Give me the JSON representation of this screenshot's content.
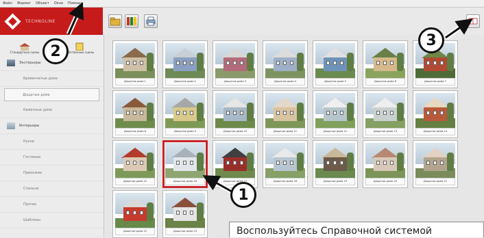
{
  "menu": [
    "Файл",
    "Формат",
    "Объект",
    "Окна",
    "Помощь"
  ],
  "logo_text": "TECHNOLINE",
  "sidebar": {
    "tabs": [
      {
        "label": "Стандартные сцены",
        "icon": "house-icon"
      },
      {
        "label": "Собственные сцены",
        "icon": "notepad-icon"
      }
    ],
    "items": [
      {
        "label": "Экстерьеры",
        "type": "group",
        "icon": "exterior-icon"
      },
      {
        "label": "Бревенчатые дома",
        "type": "item"
      },
      {
        "label": "Дощатые дома",
        "type": "item",
        "active": true
      },
      {
        "label": "Каменные дома",
        "type": "item"
      },
      {
        "label": "Интерьеры",
        "type": "group",
        "icon": "interior-icon"
      },
      {
        "label": "Кухни",
        "type": "item"
      },
      {
        "label": "Гостиные",
        "type": "item"
      },
      {
        "label": "Прихожие",
        "type": "item"
      },
      {
        "label": "Спальни",
        "type": "item"
      },
      {
        "label": "Прочее",
        "type": "item"
      },
      {
        "label": "Шаблоны",
        "type": "item"
      }
    ]
  },
  "toolbar": {
    "buttons": [
      {
        "name": "open-folder-button",
        "icon": "folder-icon"
      },
      {
        "name": "palette-button",
        "icon": "palette-icon"
      },
      {
        "name": "print-button",
        "icon": "printer-icon"
      }
    ],
    "help_button_icon": "book-icon"
  },
  "gallery": {
    "items": [
      {
        "caption": "Дощатые дома 1",
        "colors": [
          "#cfc0a8",
          "#8a6b4a",
          "#7b8f5a"
        ]
      },
      {
        "caption": "Дощатые дома 2",
        "colors": [
          "#8aa0c2",
          "#c9cfd6",
          "#6f8a54"
        ]
      },
      {
        "caption": "Дощатые дома 3",
        "colors": [
          "#b36a7a",
          "#d8d8d8",
          "#8a9a6a"
        ]
      },
      {
        "caption": "Дощатые дома 4",
        "colors": [
          "#9fb0c8",
          "#dcdcdc",
          "#7d9460"
        ]
      },
      {
        "caption": "Дощатые дома 5",
        "colors": [
          "#6f93b8",
          "#e0e0e0",
          "#6a8a50"
        ]
      },
      {
        "caption": "Дощатые дома 6",
        "colors": [
          "#d5b98a",
          "#6a7f48",
          "#8aa45e"
        ]
      },
      {
        "caption": "Дощатые дома 7",
        "colors": [
          "#b04a34",
          "#6e8648",
          "#4f6b38"
        ]
      },
      {
        "caption": "Дощатые дома 8",
        "colors": [
          "#c8b89c",
          "#8a5b3a",
          "#6f8c4c"
        ]
      },
      {
        "caption": "Дощатые дома 9",
        "colors": [
          "#d9c98a",
          "#a7a7a7",
          "#7f9a55"
        ]
      },
      {
        "caption": "Дощатые дома 10",
        "colors": [
          "#a7b8c7",
          "#e6e6e6",
          "#6d8a4a"
        ]
      },
      {
        "caption": "Дощатые дома 11",
        "colors": [
          "#d9c4a2",
          "#e4d8c8",
          "#7c9758"
        ]
      },
      {
        "caption": "Дощатые дома 12",
        "colors": [
          "#b7c6cc",
          "#efefef",
          "#80a05c"
        ]
      },
      {
        "caption": "Дощатые дома 13",
        "colors": [
          "#c9d1cf",
          "#eeeeee",
          "#84a062"
        ]
      },
      {
        "caption": "Дощатые дома 14",
        "colors": [
          "#b85a3a",
          "#e8d8c0",
          "#667f42"
        ]
      },
      {
        "caption": "Дощатые дома 15",
        "colors": [
          "#dcc9b4",
          "#b23b2c",
          "#7e9a5a"
        ]
      },
      {
        "caption": "Дощатые дома 16",
        "colors": [
          "#e2e6ea",
          "#a8b0b8",
          "#8fa571"
        ],
        "selected": true
      },
      {
        "caption": "Дощатые дома 17",
        "colors": [
          "#9a2f2a",
          "#3f3f3f",
          "#6f8a4c"
        ]
      },
      {
        "caption": "Дощатые дома 18",
        "colors": [
          "#b8c6d2",
          "#e9e9e9",
          "#86a066"
        ]
      },
      {
        "caption": "Дощатые дома 19",
        "colors": [
          "#6d5a48",
          "#c9b79a",
          "#6a8a50"
        ]
      },
      {
        "caption": "Дощатые дома 20",
        "colors": [
          "#d8c8b8",
          "#b98872",
          "#7d9458"
        ]
      },
      {
        "caption": "Дощатые дома 21",
        "colors": [
          "#b2a48e",
          "#e2d2c4",
          "#7a8c5a"
        ]
      },
      {
        "caption": "Дощатые дома 22",
        "colors": [
          "#c73a2e",
          "#d9d9d9",
          "#678a4a"
        ]
      },
      {
        "caption": "Дощатые дома 23",
        "colors": [
          "#e5e5e5",
          "#8b4f3c",
          "#6b8248"
        ]
      }
    ]
  },
  "callouts": [
    "1",
    "2",
    "3"
  ],
  "note": "Воспользуйтесь Справочной системой",
  "colors": {
    "accent": "#c61b1b",
    "selection": "#c8262b"
  }
}
